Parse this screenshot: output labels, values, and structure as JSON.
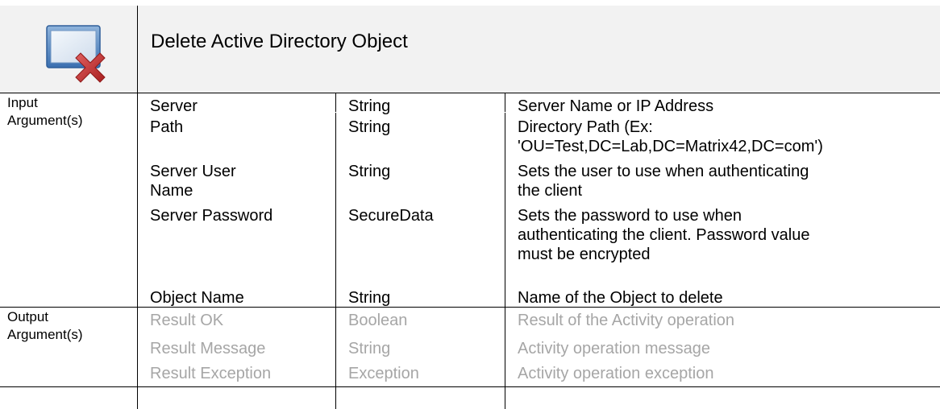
{
  "title": "Delete Active Directory Object",
  "icon": "window-delete-icon",
  "input_section_label": [
    "Input",
    "Argument(s)"
  ],
  "inputs": [
    {
      "name": [
        "Server"
      ],
      "type": "String",
      "description": [
        "Server Name or IP Address"
      ]
    },
    {
      "name": [
        "Path"
      ],
      "type": "String",
      "description": [
        "Directory Path (Ex:",
        "'OU=Test,DC=Lab,DC=Matrix42,DC=com')"
      ]
    },
    {
      "name": [
        "Server User",
        "Name"
      ],
      "type": "String",
      "description": [
        "Sets the user to use when authenticating",
        "the client"
      ]
    },
    {
      "name": [
        "Server Password"
      ],
      "type": "SecureData",
      "description": [
        "Sets the password to use when",
        "authenticating the client. Password value",
        "must be encrypted"
      ]
    },
    {
      "name": [
        "Object Name"
      ],
      "type": "String",
      "description": [
        "Name of the Object to delete"
      ]
    }
  ],
  "output_section_label": [
    "Output",
    "Argument(s)"
  ],
  "outputs": [
    {
      "name": "Result OK",
      "type": "Boolean",
      "description": "Result of the Activity operation"
    },
    {
      "name": "Result Message",
      "type": "String",
      "description": "Activity operation message"
    },
    {
      "name": "Result Exception",
      "type": "Exception",
      "description": "Activity operation exception"
    }
  ],
  "colors": {
    "header_bg": "#f2f2f2",
    "muted_text": "#a6a6a6",
    "icon_red": "#c0392b",
    "icon_blue": "#4a86c8"
  }
}
